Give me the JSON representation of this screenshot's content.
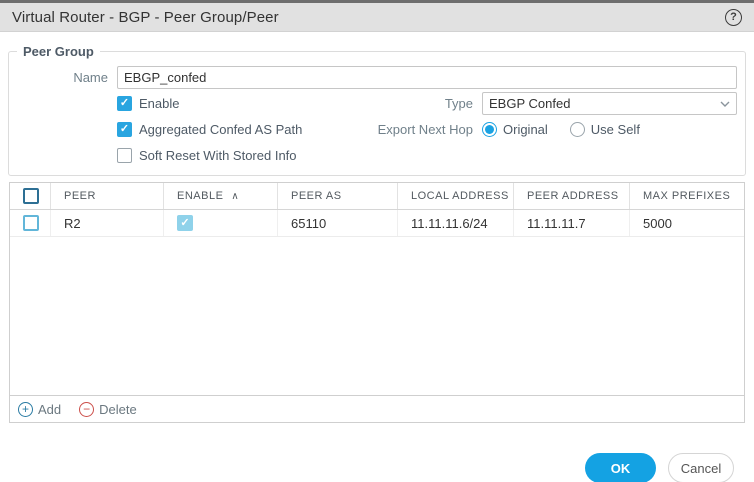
{
  "dialog": {
    "title": "Virtual Router - BGP - Peer Group/Peer",
    "help_glyph": "?"
  },
  "peer_group": {
    "legend": "Peer Group",
    "name_label": "Name",
    "name_value": "EBGP_confed",
    "checkboxes": [
      {
        "label": "Enable",
        "checked": true
      },
      {
        "label": "Aggregated Confed AS Path",
        "checked": true
      },
      {
        "label": "Soft Reset With Stored Info",
        "checked": false
      }
    ],
    "type_label": "Type",
    "type_value": "EBGP Confed",
    "export_next_hop_label": "Export Next Hop",
    "export_options": [
      {
        "label": "Original",
        "selected": true
      },
      {
        "label": "Use Self",
        "selected": false
      }
    ]
  },
  "table": {
    "columns": [
      "PEER",
      "ENABLE",
      "PEER AS",
      "LOCAL ADDRESS",
      "PEER ADDRESS",
      "MAX PREFIXES"
    ],
    "sort_column": "ENABLE",
    "sort_indicator": "∧",
    "rows": [
      {
        "peer": "R2",
        "enable": true,
        "peer_as": "65110",
        "local_address": "11.11.11.6/24",
        "peer_address": "11.11.11.7",
        "max_prefixes": "5000"
      }
    ],
    "toolbar": {
      "add_label": "Add",
      "delete_label": "Delete"
    }
  },
  "footer": {
    "ok_label": "OK",
    "cancel_label": "Cancel"
  },
  "colors": {
    "accent_blue": "#14a2e3",
    "checkbox_blue": "#29a5e0",
    "disabled_check_blue": "#8fd2ea",
    "delete_red": "#cc4f4a",
    "titlebar_gray": "#e1e1e1"
  }
}
